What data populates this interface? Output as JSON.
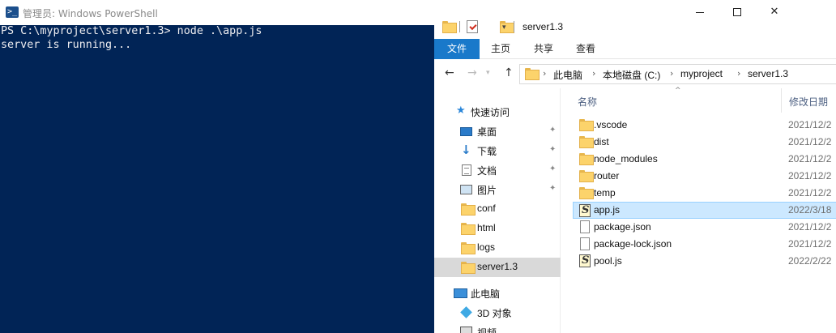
{
  "powershell": {
    "title": "管理员: Windows PowerShell",
    "lines": [
      "PS C:\\myproject\\server1.3> node .\\app.js",
      "server is running..."
    ]
  },
  "explorer": {
    "title": "server1.3",
    "window_controls": {
      "minimize": "—",
      "maximize": "☐",
      "close": "✕"
    },
    "ribbon_tabs": [
      "文件",
      "主页",
      "共享",
      "查看"
    ],
    "address": {
      "segments": [
        "此电脑",
        "本地磁盘 (C:)",
        "myproject",
        "server1.3"
      ]
    },
    "nav_pane": {
      "items": [
        {
          "label": "快速访问",
          "icon": "star-icon"
        },
        {
          "label": "桌面",
          "icon": "desktop-icon",
          "pinned": true
        },
        {
          "label": "下载",
          "icon": "download-icon",
          "pinned": true
        },
        {
          "label": "文档",
          "icon": "documents-icon",
          "pinned": true
        },
        {
          "label": "图片",
          "icon": "pictures-icon",
          "pinned": true
        },
        {
          "label": "conf",
          "icon": "folder-icon"
        },
        {
          "label": "html",
          "icon": "folder-icon"
        },
        {
          "label": "logs",
          "icon": "folder-icon"
        },
        {
          "label": "server1.3",
          "icon": "folder-icon",
          "selected": true
        },
        {
          "label": "此电脑",
          "icon": "computer-icon"
        },
        {
          "label": "3D 对象",
          "icon": "3d-objects-icon"
        },
        {
          "label": "视频",
          "icon": "video-icon"
        }
      ]
    },
    "columns": {
      "name": "名称",
      "modified": "修改日期"
    },
    "files": [
      {
        "name": ".vscode",
        "date": "2021/12/2",
        "type": "folder"
      },
      {
        "name": "dist",
        "date": "2021/12/2",
        "type": "folder"
      },
      {
        "name": "node_modules",
        "date": "2021/12/2",
        "type": "folder"
      },
      {
        "name": "router",
        "date": "2021/12/2",
        "type": "folder"
      },
      {
        "name": "temp",
        "date": "2021/12/2",
        "type": "folder"
      },
      {
        "name": "app.js",
        "date": "2022/3/18",
        "type": "js",
        "selected": true
      },
      {
        "name": "package.json",
        "date": "2021/12/2",
        "type": "doc"
      },
      {
        "name": "package-lock.json",
        "date": "2021/12/2",
        "type": "doc"
      },
      {
        "name": "pool.js",
        "date": "2022/2/22",
        "type": "js"
      }
    ]
  },
  "colors": {
    "powershell_bg": "#012456",
    "powershell_text": "#eeedf0",
    "ribbon_file_tab": "#1979ca",
    "selected_row": "#cce8ff",
    "nav_selected": "#d9d9d9"
  }
}
